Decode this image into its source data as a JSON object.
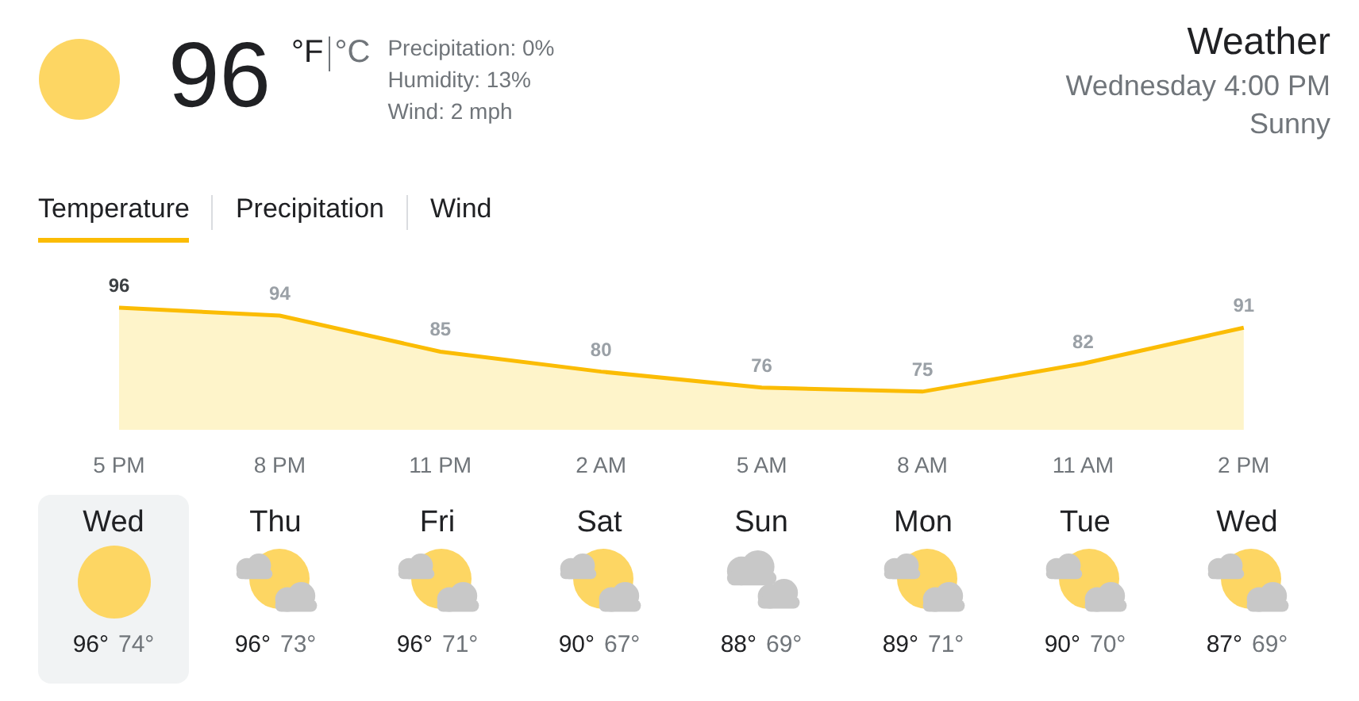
{
  "current": {
    "temperature": "96",
    "units": [
      {
        "label": "°F",
        "selected": true
      },
      {
        "label": "°C",
        "selected": false
      }
    ],
    "details": [
      "Precipitation: 0%",
      "Humidity: 13%",
      "Wind: 2 mph"
    ]
  },
  "header": {
    "title": "Weather",
    "datetime": "Wednesday 4:00 PM",
    "condition": "Sunny"
  },
  "tabs": [
    {
      "label": "Temperature",
      "selected": true
    },
    {
      "label": "Precipitation",
      "selected": false
    },
    {
      "label": "Wind",
      "selected": false
    }
  ],
  "chart_data": {
    "type": "area",
    "categories": [
      "5 PM",
      "8 PM",
      "11 PM",
      "2 AM",
      "5 AM",
      "8 AM",
      "11 AM",
      "2 PM"
    ],
    "values": [
      96,
      94,
      85,
      80,
      76,
      75,
      82,
      91
    ],
    "data_labels": true
  },
  "days": [
    {
      "day": "Wed",
      "kind": "sunny",
      "high": "96°",
      "low": "74°",
      "selected": true
    },
    {
      "day": "Thu",
      "kind": "partly_cloudy",
      "high": "96°",
      "low": "73°",
      "selected": false
    },
    {
      "day": "Fri",
      "kind": "partly_cloudy",
      "high": "96°",
      "low": "71°",
      "selected": false
    },
    {
      "day": "Sat",
      "kind": "partly_cloudy",
      "high": "90°",
      "low": "67°",
      "selected": false
    },
    {
      "day": "Sun",
      "kind": "cloudy",
      "high": "88°",
      "low": "69°",
      "selected": false
    },
    {
      "day": "Mon",
      "kind": "partly_cloudy",
      "high": "89°",
      "low": "71°",
      "selected": false
    },
    {
      "day": "Tue",
      "kind": "partly_cloudy",
      "high": "90°",
      "low": "70°",
      "selected": false
    },
    {
      "day": "Wed",
      "kind": "partly_cloudy",
      "high": "87°",
      "low": "69°",
      "selected": false
    }
  ]
}
